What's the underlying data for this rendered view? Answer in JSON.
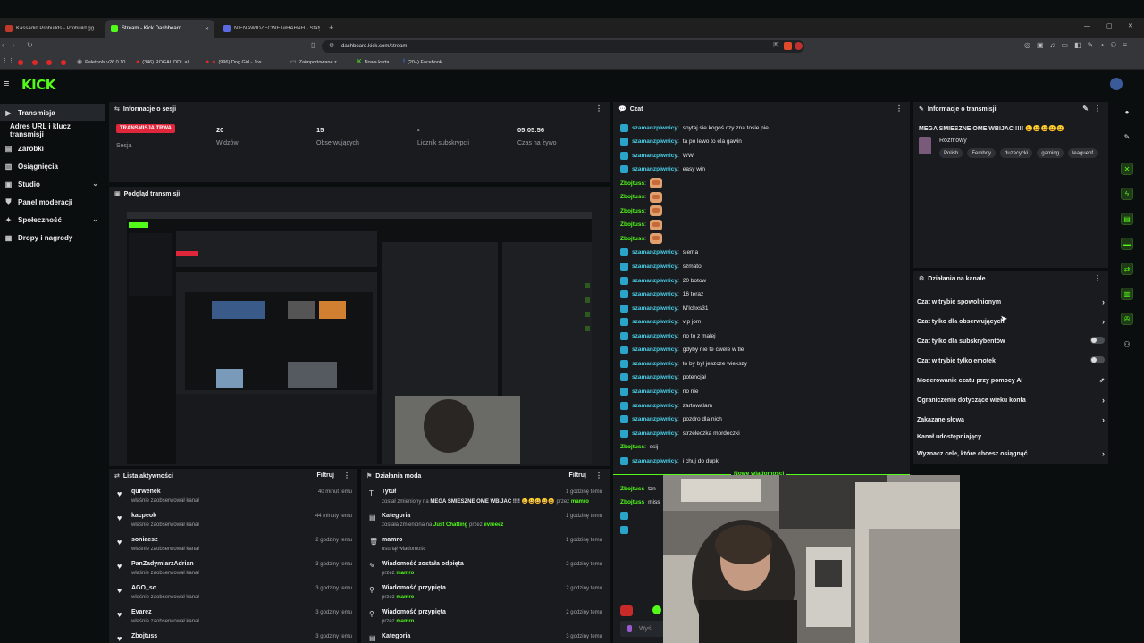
{
  "browser": {
    "tabs": [
      {
        "label": "Kassadin Probuilds - Probuild.gg"
      },
      {
        "label": "Stream - Kick Dashboard"
      },
      {
        "label": "NIENAWIDZECWEL#HAHAH - Staty"
      }
    ],
    "url": "dashboard.kick.com/stream",
    "bookmarks": [
      {
        "label": "Paletools v26.0.10"
      },
      {
        "label": "(346) ROGAL DDL al..."
      },
      {
        "label": "(996) Dog Girl - Jos..."
      },
      {
        "label": "Zaimportowane z..."
      },
      {
        "label": "Nowa karta"
      },
      {
        "label": "(20+) Facebook"
      }
    ]
  },
  "kick": {
    "logo": "KICK"
  },
  "sidebar": {
    "items": [
      {
        "label": "Transmisja"
      },
      {
        "label": "Adres URL i klucz transmisji"
      },
      {
        "label": "Zarobki"
      },
      {
        "label": "Osiągnięcia"
      },
      {
        "label": "Studio"
      },
      {
        "label": "Panel moderacji"
      },
      {
        "label": "Społeczność"
      },
      {
        "label": "Dropy i nagrody"
      }
    ]
  },
  "session": {
    "title": "Informacje o sesji",
    "live_badge": "TRANSMISJA TRWA",
    "session_label": "Sesja",
    "stats": [
      {
        "value": "20",
        "label": "Widzów"
      },
      {
        "value": "15",
        "label": "Obserwujących"
      },
      {
        "value": "-",
        "label": "Licznik subskrypcji"
      },
      {
        "value": "05:05:56",
        "label": "Czas na żywo"
      }
    ]
  },
  "preview": {
    "title": "Podgląd transmisji"
  },
  "activity": {
    "title": "Lista aktywności",
    "filter": "Filtruj",
    "items": [
      {
        "name": "qurwenek",
        "sub": "właśnie zaobserwował kanał",
        "time": "40 minut temu"
      },
      {
        "name": "kacpeok",
        "sub": "właśnie zaobserwował kanał",
        "time": "44 minuty temu"
      },
      {
        "name": "soniaesz",
        "sub": "właśnie zaobserwował kanał",
        "time": "2 godziny temu"
      },
      {
        "name": "PanZadymiarzAdrian",
        "sub": "właśnie zaobserwował kanał",
        "time": "3 godziny temu"
      },
      {
        "name": "AGO_sc",
        "sub": "właśnie zaobserwował kanał",
        "time": "3 godziny temu"
      },
      {
        "name": "Evarez",
        "sub": "właśnie zaobserwował kanał",
        "time": "3 godziny temu"
      },
      {
        "name": "Zbojtuss",
        "sub": "",
        "time": "3 godziny temu"
      }
    ]
  },
  "mod": {
    "title": "Działania moda",
    "filter": "Filtruj",
    "items": [
      {
        "name": "Tytuł",
        "sub_a": "został zmieniony na ",
        "sub_b": "MEGA SMIESZNE OME WBIJAC !!!! 😀😀😀😀😀",
        "sub_c": " przez ",
        "sub_d": "mamro",
        "time": "1 godzinę temu"
      },
      {
        "name": "Kategoria",
        "sub_a": "została zmieniona na ",
        "sub_b": "Just Chatting",
        "sub_c": " przez ",
        "sub_d": "evreeez",
        "time": "1 godzinę temu"
      },
      {
        "name": "mamro",
        "sub_a": "usunął wiadomość",
        "sub_b": "",
        "sub_c": "",
        "sub_d": "",
        "time": "1 godzinę temu"
      },
      {
        "name": "Wiadomość została odpięta",
        "sub_a": "przez ",
        "sub_b": "",
        "sub_c": "",
        "sub_d": "mamro",
        "time": "2 godziny temu"
      },
      {
        "name": "Wiadomość przypięta",
        "sub_a": "przez ",
        "sub_b": "",
        "sub_c": "",
        "sub_d": "mamro",
        "time": "2 godziny temu"
      },
      {
        "name": "Wiadomość przypięta",
        "sub_a": "przez ",
        "sub_b": "",
        "sub_c": "",
        "sub_d": "mamro",
        "time": "2 godziny temu"
      },
      {
        "name": "Kategoria",
        "sub_a": "",
        "sub_b": "",
        "sub_c": "",
        "sub_d": "",
        "time": "3 godziny temu"
      }
    ]
  },
  "chat": {
    "title": "Czat",
    "new_messages": "Nowe wiadomości",
    "input_placeholder": "Wyśl",
    "messages": [
      {
        "user": "szamanzpiwnicy",
        "text": "spytaj sie kogoś czy zna tosie pie"
      },
      {
        "user": "szamanzpiwnicy",
        "text": "ta po lewo to ela gawin"
      },
      {
        "user": "szamanzpiwnicy",
        "text": "WW"
      },
      {
        "user": "szamanzpiwnicy",
        "text": "easy win"
      },
      {
        "user": "Zbojtuss",
        "text": ""
      },
      {
        "user": "Zbojtuss",
        "text": ""
      },
      {
        "user": "Zbojtuss",
        "text": ""
      },
      {
        "user": "Zbojtuss",
        "text": ""
      },
      {
        "user": "Zbojtuss",
        "text": ""
      },
      {
        "user": "szamanzpiwnicy",
        "text": "siema"
      },
      {
        "user": "szamanzpiwnicy",
        "text": "szmato"
      },
      {
        "user": "szamanzpiwnicy",
        "text": "20 botow"
      },
      {
        "user": "szamanzpiwnicy",
        "text": "16 teraz"
      },
      {
        "user": "szamanzpiwnicy",
        "text": "M'lchxs31"
      },
      {
        "user": "szamanzpiwnicy",
        "text": "vip jom"
      },
      {
        "user": "szamanzpiwnicy",
        "text": "no to z malej"
      },
      {
        "user": "szamanzpiwnicy",
        "text": "gdyby nie te cwele w tle"
      },
      {
        "user": "szamanzpiwnicy",
        "text": "to by był jeszcze wiekszy"
      },
      {
        "user": "szamanzpiwnicy",
        "text": "potencjał"
      },
      {
        "user": "szamanzpiwnicy",
        "text": "no nie"
      },
      {
        "user": "szamanzpiwnicy",
        "text": "zartowalam"
      },
      {
        "user": "szamanzpiwnicy",
        "text": "pozdro dla nich"
      },
      {
        "user": "szamanzpiwnicy",
        "text": "strzeleczka mordeczki"
      },
      {
        "user": "Zbojtuss",
        "text": "ssij"
      },
      {
        "user": "szamanzpiwnicy",
        "text": "i chuj do dupki"
      }
    ],
    "lower": [
      {
        "user": "Zbojtuss",
        "text": "tzn"
      },
      {
        "user": "Zbojtuss",
        "text": "miss"
      }
    ]
  },
  "stream_info": {
    "title": "Informacje o transmisji",
    "stream_title": "MEGA SMIESZNE OME WBIJAC !!!! 😀😀😀😀😀",
    "category": "Rozmowy",
    "tags": [
      "Polish",
      "Femboy",
      "duzecycki",
      "gaming",
      "leagueof"
    ]
  },
  "channel": {
    "title": "Działania na kanale",
    "items": [
      {
        "label": "Czat w trybie spowolnionym",
        "kind": "arrow"
      },
      {
        "label": "Czat tylko dla obserwujących",
        "kind": "arrow"
      },
      {
        "label": "Czat tylko dla subskrybentów",
        "kind": "toggle"
      },
      {
        "label": "Czat w trybie tylko emotek",
        "kind": "toggle"
      },
      {
        "label": "Moderowanie czatu przy pomocy AI",
        "kind": "external"
      },
      {
        "label": "Ograniczenie dotyczące wieku konta",
        "kind": "arrow"
      },
      {
        "label": "Zakazane słowa",
        "kind": "arrow"
      },
      {
        "label": "Kanał udostępniający",
        "kind": "none"
      },
      {
        "label": "Wyznacz cele, które chcesz osiągnąć",
        "kind": "arrow"
      }
    ]
  },
  "colors": {
    "accent": "#53fc18",
    "live": "#e0263a",
    "panel": "#191b1f",
    "bg": "#0b0e0f"
  }
}
